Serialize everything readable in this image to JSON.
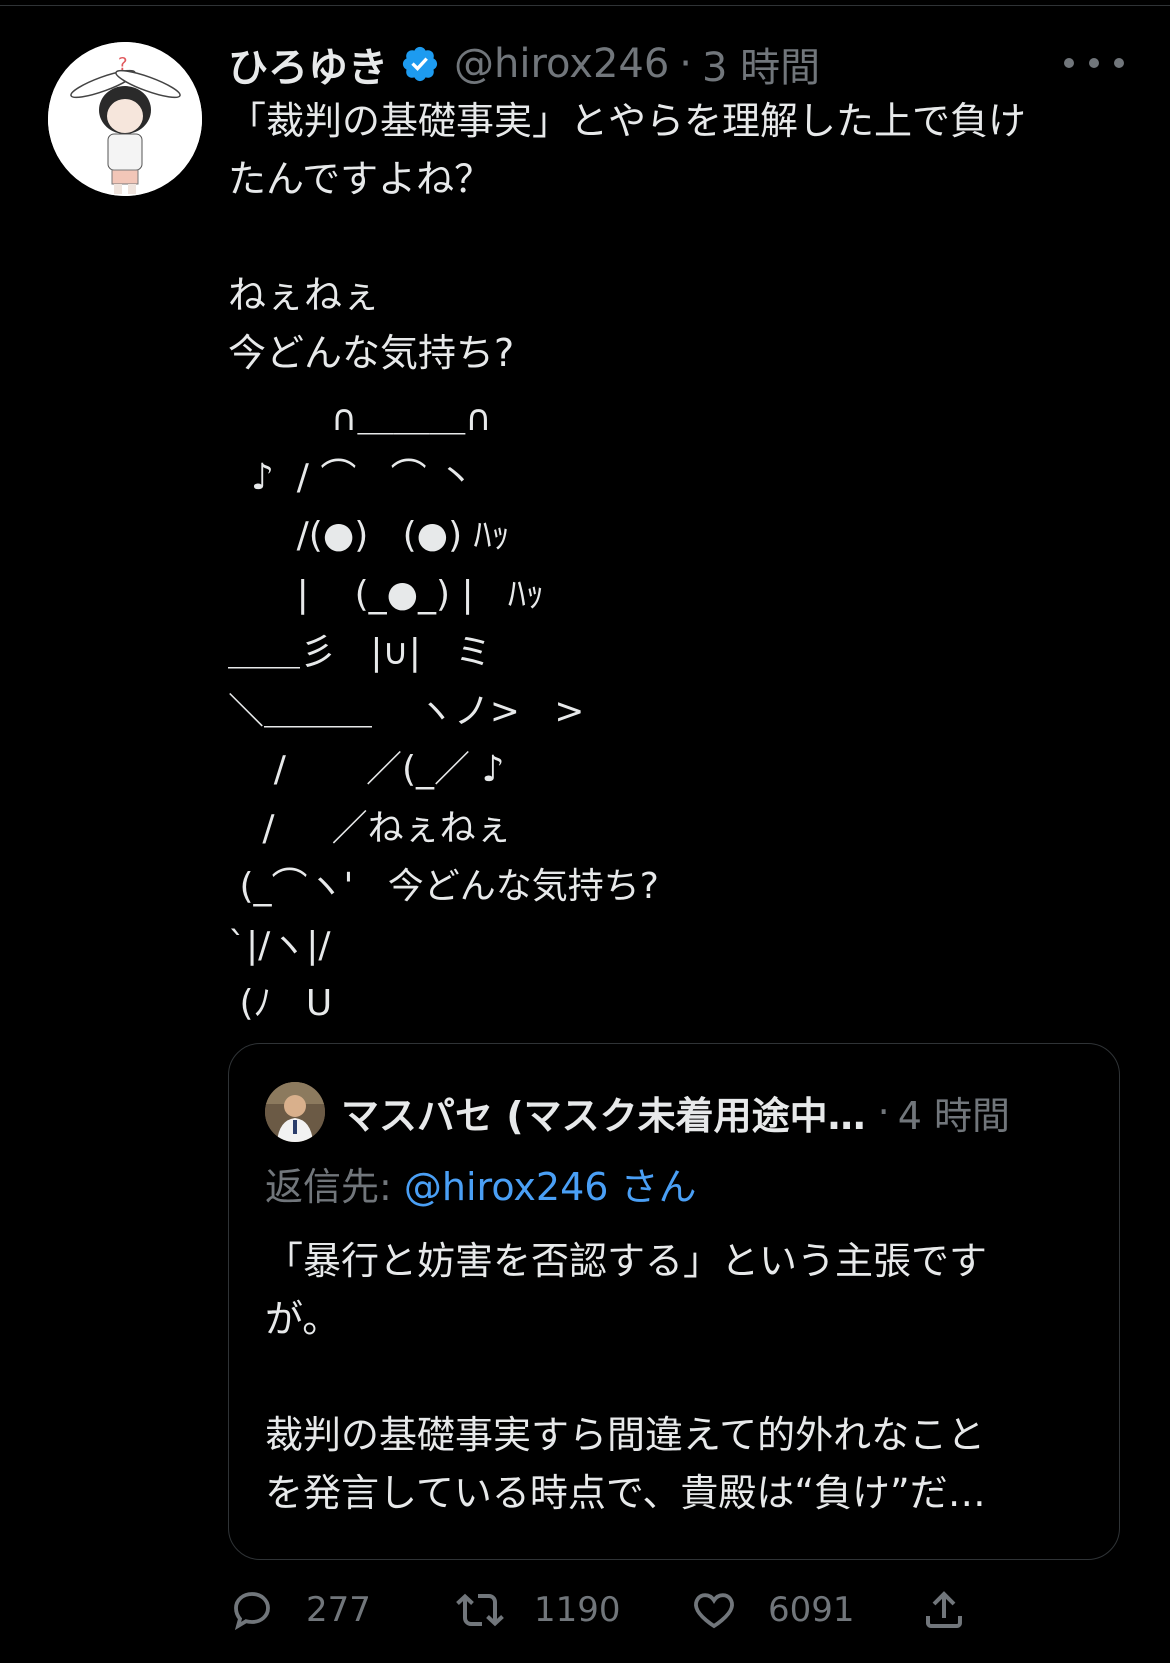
{
  "tweet": {
    "name": "ひろゆき",
    "handle": "@hirox246",
    "time": "3 時間",
    "text_lines": [
      "「裁判の基礎事実」とやらを理解した上で負け",
      "たんですよね？",
      "",
      "ねぇねぇ",
      "今どんな気持ち?"
    ],
    "ascii_art_lines": [
      "         ∩＿＿＿∩",
      "  ♪  / ⌒   ⌒ 丶",
      "      /(●)   (●) ﾊｯ",
      "      |    (_●_) |   ﾊｯ",
      "＿＿彡   |∪|   ミ",
      "＼＿＿＿    ヽノ>   >",
      "    /       ／(_／ ♪",
      "   /     ／ねぇねぇ",
      " (_⌒ヽ'   今どんな気持ち?",
      "`|/ヽ|/",
      " (ﾉ   U"
    ]
  },
  "quote": {
    "name": "マスパセ (マスク未着用途中…",
    "time": "4 時間",
    "reply_label": "返信先:",
    "reply_mention": "@hirox246 さん",
    "text_lines": [
      "「暴行と妨害を否認する」という主張です",
      "が。",
      "",
      "裁判の基礎事実すら間違えて的外れなこと",
      "を発言している時点で、貴殿は“負け”だ…"
    ]
  },
  "actions": {
    "replies": "277",
    "retweets": "1190",
    "likes": "6091"
  },
  "colors": {
    "background": "#000000",
    "text": "#e7e9ea",
    "muted": "#71767b",
    "accent": "#4a9ff5",
    "verified": "#1d9bf0"
  }
}
